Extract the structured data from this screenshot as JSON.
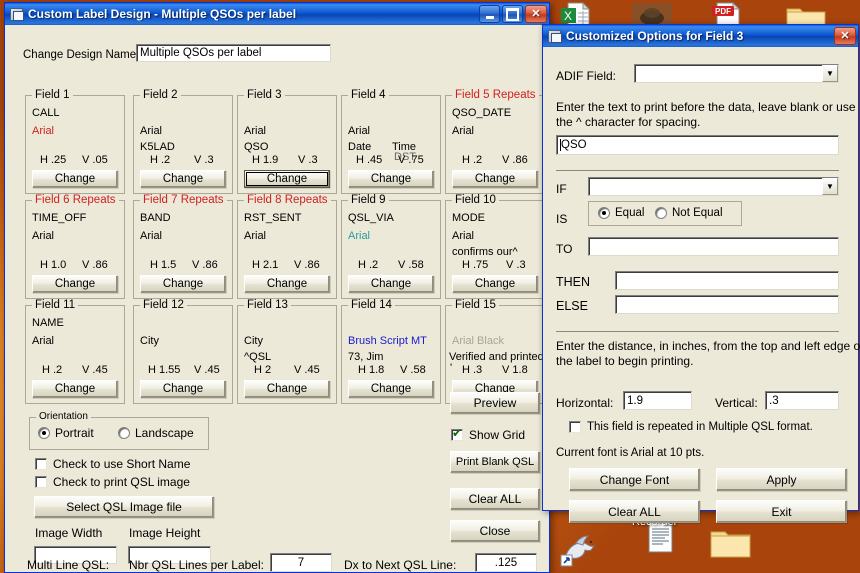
{
  "desktop": {
    "icons_top": [
      {
        "name": "excel-spreadsheet-icon",
        "label": ""
      },
      {
        "name": "image-thumbnail-icon",
        "label": ""
      },
      {
        "name": "pdf-document-icon",
        "label": "PDF"
      },
      {
        "name": "folder-icon",
        "label": ""
      }
    ],
    "icons_bottom": [
      {
        "name": "pegasus-shortcut-icon",
        "label": ""
      },
      {
        "name": "recorder-document-icon",
        "label": "Recorder"
      },
      {
        "name": "folder-icon",
        "label": ""
      }
    ]
  },
  "main_window": {
    "title": "Custom Label Design - Multiple QSOs per label",
    "titlebar_icon": "window-document-icon",
    "buttons": {
      "minimize": "_",
      "maximize": "□",
      "close": "✕"
    },
    "design_name_label": "Change Design Name:",
    "design_name_value": "Multiple QSOs per label",
    "change_button_label": "Change",
    "fields": [
      {
        "caption": "Field 1",
        "caption_red": false,
        "line1": "CALL",
        "line1_color": "black",
        "line2": "Arial",
        "line2_color": "red",
        "line3": "",
        "h": "H .25",
        "v": "V .05",
        "focused": false
      },
      {
        "caption": "Field 2",
        "caption_red": false,
        "line1": "Arial",
        "line1_color": "black",
        "line2": "K5LAD",
        "line2_color": "black",
        "line3": "",
        "h": "H .2",
        "v": "V .3",
        "focused": false
      },
      {
        "caption": "Field 3",
        "caption_red": false,
        "line1": "Arial",
        "line1_color": "black",
        "line2": "QSO",
        "line2_color": "black",
        "line3": "",
        "h": "H 1.9",
        "v": "V .3",
        "focused": true
      },
      {
        "caption": "Field 4",
        "caption_red": false,
        "line1": "Arial",
        "line1_color": "black",
        "line2": "Date",
        "line2_color": "black",
        "line2b": "Time",
        "line3": "DST",
        "h": "H .45",
        "v": "V .75",
        "focused": false
      },
      {
        "caption": "Field 5 Repeats",
        "caption_red": true,
        "line1": "QSO_DATE",
        "line1_color": "black",
        "line2": "Arial",
        "line2_color": "black",
        "line3": "",
        "h": "H .2",
        "v": "V .86",
        "focused": false
      },
      {
        "caption": "Field 6 Repeats",
        "caption_red": true,
        "line1": "TIME_OFF",
        "line1_color": "black",
        "line2": "Arial",
        "line2_color": "black",
        "line3": "",
        "h": "H 1.0",
        "v": "V .86",
        "focused": false
      },
      {
        "caption": "Field 7 Repeats",
        "caption_red": true,
        "line1": "BAND",
        "line1_color": "black",
        "line2": "Arial",
        "line2_color": "black",
        "line3": "",
        "h": "H 1.5",
        "v": "V .86",
        "focused": false
      },
      {
        "caption": "Field 8 Repeats",
        "caption_red": true,
        "line1": "RST_SENT",
        "line1_color": "black",
        "line2": "Arial",
        "line2_color": "black",
        "line3": "",
        "h": "H 2.1",
        "v": "V .86",
        "focused": false
      },
      {
        "caption": "Field 9",
        "caption_red": false,
        "line1": "QSL_VIA",
        "line1_color": "black",
        "line2": "Arial",
        "line2_color": "teal",
        "line3": "",
        "h": "H .2",
        "v": "V .58",
        "focused": false
      },
      {
        "caption": "Field 10",
        "caption_red": false,
        "line1": "MODE",
        "line1_color": "black",
        "line2": "Arial",
        "line2_color": "black",
        "line3": "confirms our^",
        "h": "H .75",
        "v": "V .3",
        "focused": false
      },
      {
        "caption": "Field 11",
        "caption_red": false,
        "line1": "NAME",
        "line1_color": "black",
        "line2": "Arial",
        "line2_color": "black",
        "line3": "",
        "h": "H .2",
        "v": "V .45",
        "focused": false
      },
      {
        "caption": "Field 12",
        "caption_red": false,
        "line1": "",
        "line1_color": "black",
        "line2": "City",
        "line2_color": "black",
        "line3": "",
        "h": "H 1.55",
        "v": "V .45",
        "focused": false
      },
      {
        "caption": "Field 13",
        "caption_red": false,
        "line1": "",
        "line1_color": "black",
        "line2": "City",
        "line2_color": "black",
        "line3": "^QSL",
        "h": "H 2",
        "v": "V .45",
        "focused": false
      },
      {
        "caption": "Field 14",
        "caption_red": false,
        "line1": "",
        "line1_color": "black",
        "line2": "Brush Script MT",
        "line2_color": "blue",
        "line3": "73, Jim",
        "h": "H 1.8",
        "v": "V .58",
        "focused": false
      },
      {
        "caption": "Field 15",
        "caption_red": false,
        "line1": "",
        "line1_color": "black",
        "line2": "Arial Black",
        "line2_color": "gray",
        "line3": "Verified and printed",
        "line4": "'",
        "h": "H .3",
        "v": "V 1.8",
        "focused": false
      }
    ],
    "orientation": {
      "caption": "Orientation",
      "portrait_label": "Portrait",
      "landscape_label": "Landscape",
      "selected": "Portrait"
    },
    "short_name_checkbox": {
      "label": "Check to use Short Name",
      "checked": false
    },
    "qsl_image_checkbox": {
      "label": "Check to print QSL image",
      "checked": false
    },
    "select_qsl_button": "Select QSL Image file",
    "image_width_label": "Image Width",
    "image_height_label": "Image Height",
    "image_width_value": "",
    "image_height_value": "",
    "multi_line_label": "Multi Line QSL:",
    "nbr_lines_label": "Nbr QSL Lines per Label:",
    "nbr_lines_value": "7",
    "dx_label": "Dx to Next QSL Line:",
    "dx_value": ".125",
    "right_buttons": {
      "preview": "Preview",
      "show_grid_label": "Show Grid",
      "show_grid_checked": true,
      "print_blank": "Print Blank QSL",
      "clear_all": "Clear ALL",
      "close": "Close"
    }
  },
  "dialog": {
    "title": "Customized Options for Field 3",
    "titlebar_icon": "window-document-icon",
    "close_label": "✕",
    "adif_label": "ADIF Field:",
    "adif_value": "",
    "prefix_help_line1": "Enter the text to print before the data, leave blank or use",
    "prefix_help_line2": "the ^ character for spacing.",
    "prefix_value": "QSO",
    "if_label": "IF",
    "if_value": "",
    "is_label": "IS",
    "is_equal_label": "Equal",
    "is_not_equal_label": "Not Equal",
    "is_selected": "Equal",
    "to_label": "TO",
    "to_value": "",
    "then_label": "THEN",
    "then_value": "",
    "else_label": "ELSE",
    "else_value": "",
    "distance_help_line1": "Enter the distance, in inches, from the top and left edge of",
    "distance_help_line2": "the label to begin printing.",
    "horizontal_label": "Horizontal:",
    "horizontal_value": "1.9",
    "vertical_label": "Vertical:",
    "vertical_value": ".3",
    "repeat_checkbox": {
      "label": "This field is repeated in Multiple QSL format.",
      "checked": false
    },
    "current_font_text": "Current font is Arial at 10 pts.",
    "buttons": {
      "change_font": "Change Font",
      "apply": "Apply",
      "clear_all": "Clear ALL",
      "exit": "Exit"
    }
  }
}
